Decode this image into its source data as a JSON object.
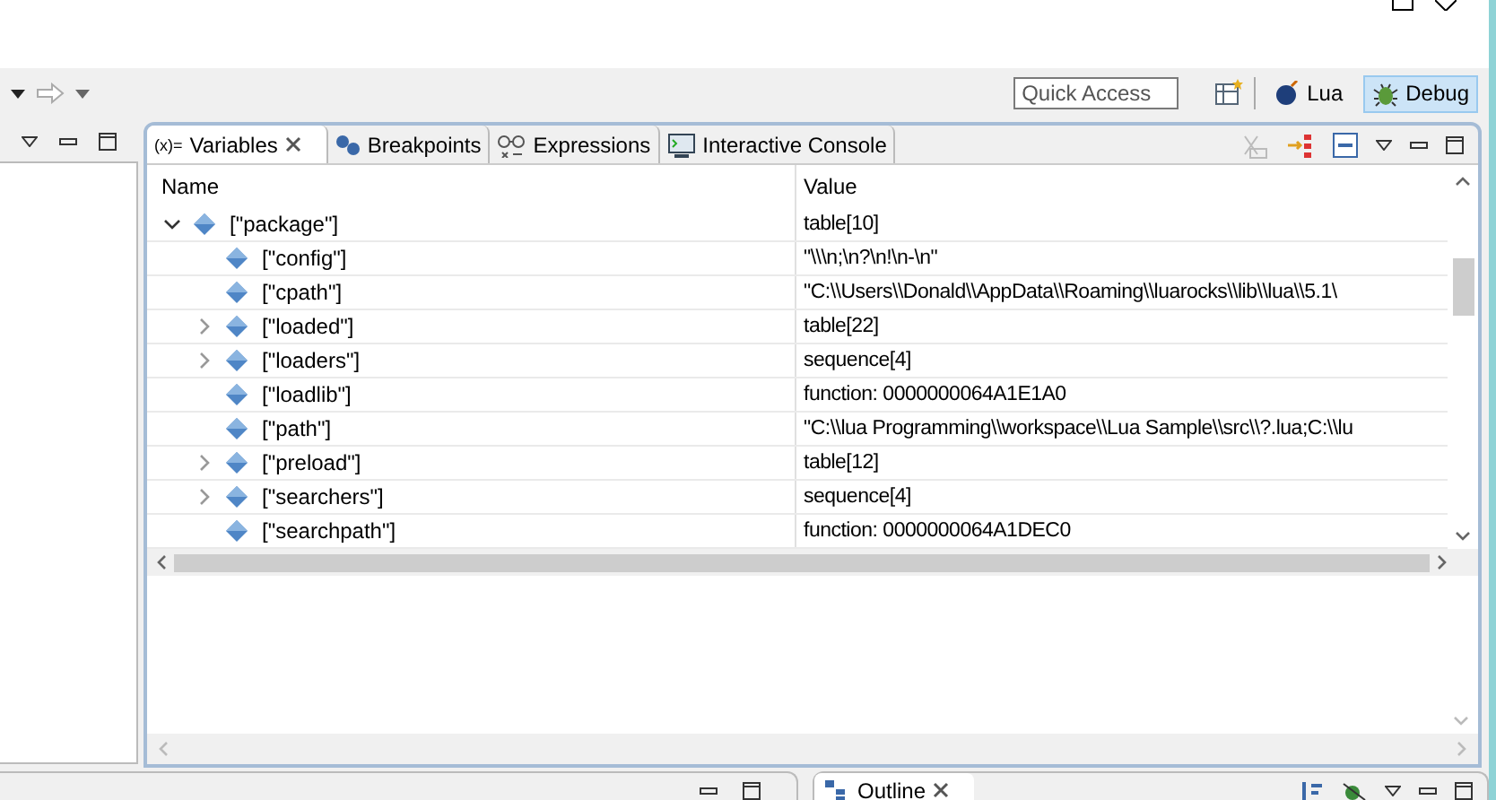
{
  "toolbar": {
    "quick_access": {
      "placeholder": "Quick Access"
    },
    "perspectives": [
      {
        "label": "Lua",
        "selected": false
      },
      {
        "label": "Debug",
        "selected": true
      }
    ]
  },
  "views": {
    "tabs": [
      {
        "label": "Variables",
        "icon_text": "(x)=",
        "selected": true,
        "closable": true
      },
      {
        "label": "Breakpoints",
        "selected": false
      },
      {
        "label": "Expressions",
        "selected": false
      },
      {
        "label": "Interactive Console",
        "selected": false
      }
    ],
    "table": {
      "columns": [
        "Name",
        "Value"
      ],
      "rows": [
        {
          "name": "[\"package\"]",
          "value": "table[10]",
          "expanded": true,
          "children": [
            {
              "name": "[\"config\"]",
              "value": "\"\\\\\\n;\\n?\\n!\\n-\\n\""
            },
            {
              "name": "[\"cpath\"]",
              "value": "\"C:\\\\Users\\\\Donald\\\\AppData\\\\Roaming\\\\luarocks\\\\lib\\\\lua\\\\5.1\\"
            },
            {
              "name": "[\"loaded\"]",
              "value": "table[22]",
              "expanded": false
            },
            {
              "name": "[\"loaders\"]",
              "value": "sequence[4]",
              "expanded": false
            },
            {
              "name": "[\"loadlib\"]",
              "value": "function: 0000000064A1E1A0"
            },
            {
              "name": "[\"path\"]",
              "value": "\"C:\\\\lua Programming\\\\workspace\\\\Lua Sample\\\\src\\\\?.lua;C:\\\\lu"
            },
            {
              "name": "[\"preload\"]",
              "value": "table[12]",
              "expanded": false
            },
            {
              "name": "[\"searchers\"]",
              "value": "sequence[4]",
              "expanded": false
            },
            {
              "name": "[\"searchpath\"]",
              "value": "function: 0000000064A1DEC0"
            }
          ]
        }
      ]
    }
  },
  "bottom": {
    "tabs": [
      {
        "label": "Outline",
        "selected": true,
        "closable": true
      }
    ]
  }
}
